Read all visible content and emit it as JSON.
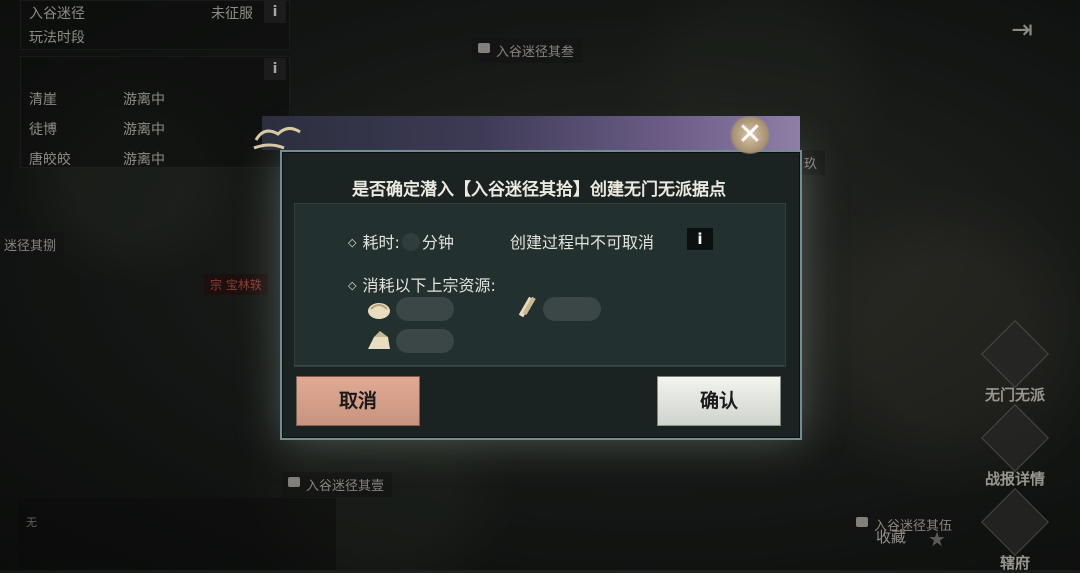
{
  "hud": {
    "panel1": {
      "row1_name": "入谷迷径",
      "row1_status": "未征服",
      "row2_name": "玩法时段"
    },
    "panel2": {
      "rows": [
        {
          "name": "清崖",
          "status": "游离中"
        },
        {
          "name": "徒博",
          "status": "游离中"
        },
        {
          "name": "唐皎皎",
          "status": "游离中"
        }
      ]
    },
    "info_glyph": "i",
    "exit_glyph": "⇥"
  },
  "map": {
    "labels": [
      "入谷迷径其叁",
      "迷径其捌",
      "入谷迷径其壹",
      "入谷迷径其伍"
    ],
    "sect_tag": "宗",
    "sect_name": "宝林轶",
    "partial_label": "玖"
  },
  "side_buttons": {
    "wumen": "无门无派",
    "battle_report": "战报详情",
    "jurisdiction": "辖府"
  },
  "favorite": {
    "label": "收藏",
    "star": "★"
  },
  "mic_label": "无",
  "dialog": {
    "title": "是否确定潜入【入谷迷径其拾】创建无门无派据点",
    "close_glyph": "✕",
    "time_label": "耗时:",
    "time_unit": "分钟",
    "cannot_cancel": "创建过程中不可取消",
    "consume_label": "消耗以下上宗资源:",
    "bullet_glyph": "◇",
    "resources": [
      {
        "icon": "bun-icon"
      },
      {
        "icon": "wood-icon"
      },
      {
        "icon": "ingot-icon"
      }
    ],
    "cancel_label": "取消",
    "confirm_label": "确认"
  }
}
